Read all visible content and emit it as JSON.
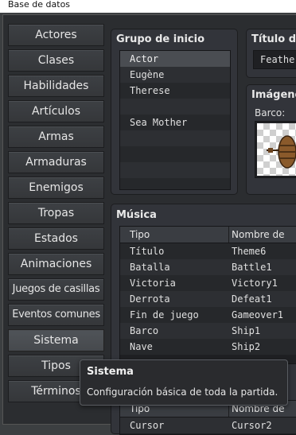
{
  "window": {
    "title": "Base de datos"
  },
  "nav": {
    "items": [
      {
        "label": "Actores"
      },
      {
        "label": "Clases"
      },
      {
        "label": "Habilidades"
      },
      {
        "label": "Artículos"
      },
      {
        "label": "Armas"
      },
      {
        "label": "Armaduras"
      },
      {
        "label": "Enemigos"
      },
      {
        "label": "Tropas"
      },
      {
        "label": "Estados"
      },
      {
        "label": "Animaciones"
      },
      {
        "label": "Juegos de casillas"
      },
      {
        "label": "Eventos comunes"
      },
      {
        "label": "Sistema"
      },
      {
        "label": "Tipos"
      },
      {
        "label": "Términos"
      }
    ],
    "active": "Sistema"
  },
  "starting_party": {
    "title": "Grupo de inicio",
    "members": [
      "Actor",
      "Eugène",
      "Therese",
      "",
      "Sea Mother",
      "",
      "",
      "",
      ""
    ]
  },
  "game_title": {
    "title": "Título d",
    "value": "Feather"
  },
  "images": {
    "title": "Imágene",
    "boat_label": "Barco:"
  },
  "music": {
    "title": "Música",
    "columns": [
      "Tipo",
      "Nombre de"
    ],
    "rows": [
      {
        "type": "Título",
        "name": "Theme6"
      },
      {
        "type": "Batalla",
        "name": "Battle1"
      },
      {
        "type": "Victoria",
        "name": "Victory1"
      },
      {
        "type": "Derrota",
        "name": "Defeat1"
      },
      {
        "type": "Fin de juego",
        "name": "Gameover1"
      },
      {
        "type": "Barco",
        "name": "Ship1"
      },
      {
        "type": "Nave",
        "name": "Ship2"
      }
    ]
  },
  "sounds": {
    "columns": [
      "Tipo",
      "Nombre de"
    ],
    "rows": [
      {
        "type": "Cursor",
        "name": "Cursor2"
      }
    ]
  },
  "tooltip": {
    "title": "Sistema",
    "body": "Configuración básica de toda la partida."
  }
}
